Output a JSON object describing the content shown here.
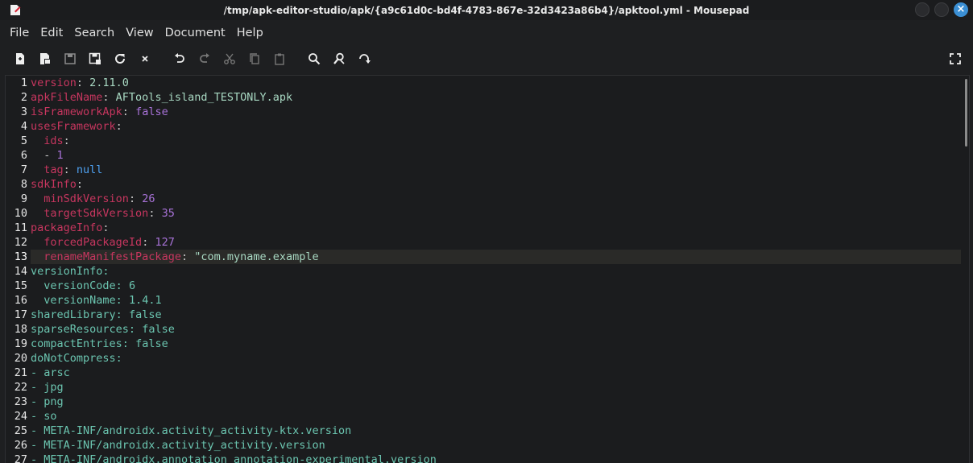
{
  "window": {
    "title": "/tmp/apk-editor-studio/apk/{a9c61d0c-bd4f-4783-867e-32d3423a86b4}/apktool.yml - Mousepad"
  },
  "menu": [
    "File",
    "Edit",
    "Search",
    "View",
    "Document",
    "Help"
  ],
  "toolbar": {
    "icons": [
      "new-document-icon",
      "new-window-icon",
      "save-icon",
      "save-as-icon",
      "reload-icon",
      "close-icon",
      "undo-icon",
      "redo-icon",
      "cut-icon",
      "copy-icon",
      "paste-icon",
      "search-icon",
      "replace-icon",
      "goto-icon",
      "fullscreen-icon"
    ]
  },
  "editor": {
    "current_line": 13,
    "lines": [
      {
        "n": "1",
        "indent": "",
        "key": "version",
        "sep": ": ",
        "val": "2.11.0",
        "type": "k",
        "vtype": "s"
      },
      {
        "n": "2",
        "indent": "",
        "key": "apkFileName",
        "sep": ": ",
        "val": "AFTools_island_TESTONLY.apk",
        "type": "k",
        "vtype": "s"
      },
      {
        "n": "3",
        "indent": "",
        "key": "isFrameworkApk",
        "sep": ": ",
        "val": "false",
        "type": "k",
        "vtype": "bool"
      },
      {
        "n": "4",
        "indent": "",
        "key": "usesFramework",
        "sep": ":",
        "val": "",
        "type": "k",
        "vtype": "s"
      },
      {
        "n": "5",
        "indent": "  ",
        "key": "ids",
        "sep": ":",
        "val": "",
        "type": "k",
        "vtype": "s"
      },
      {
        "n": "6",
        "indent": "  ",
        "key": "- ",
        "sep": "",
        "val": "1",
        "type": "p",
        "vtype": "num"
      },
      {
        "n": "7",
        "indent": "  ",
        "key": "tag",
        "sep": ": ",
        "val": "null",
        "type": "k",
        "vtype": "null"
      },
      {
        "n": "8",
        "indent": "",
        "key": "sdkInfo",
        "sep": ":",
        "val": "",
        "type": "k",
        "vtype": "s"
      },
      {
        "n": "9",
        "indent": "  ",
        "key": "minSdkVersion",
        "sep": ": ",
        "val": "26",
        "type": "k",
        "vtype": "num"
      },
      {
        "n": "10",
        "indent": "  ",
        "key": "targetSdkVersion",
        "sep": ": ",
        "val": "35",
        "type": "k",
        "vtype": "num"
      },
      {
        "n": "11",
        "indent": "",
        "key": "packageInfo",
        "sep": ":",
        "val": "",
        "type": "k",
        "vtype": "s"
      },
      {
        "n": "12",
        "indent": "  ",
        "key": "forcedPackageId",
        "sep": ": ",
        "val": "127",
        "type": "k",
        "vtype": "num"
      },
      {
        "n": "13",
        "indent": "  ",
        "key": "renameManifestPackage",
        "sep": ": ",
        "val": "\"com.myname.example",
        "type": "k",
        "vtype": "s"
      },
      {
        "n": "14",
        "indent": "",
        "key": "versionInfo",
        "sep": ":",
        "val": "",
        "type": "k2",
        "vtype": "s"
      },
      {
        "n": "15",
        "indent": "  ",
        "key": "versionCode",
        "sep": ": ",
        "val": "6",
        "type": "k2",
        "vtype": "s"
      },
      {
        "n": "16",
        "indent": "  ",
        "key": "versionName",
        "sep": ": ",
        "val": "1.4.1",
        "type": "k2",
        "vtype": "s"
      },
      {
        "n": "17",
        "indent": "",
        "key": "sharedLibrary",
        "sep": ": ",
        "val": "false",
        "type": "k2",
        "vtype": "s"
      },
      {
        "n": "18",
        "indent": "",
        "key": "sparseResources",
        "sep": ": ",
        "val": "false",
        "type": "k2",
        "vtype": "s"
      },
      {
        "n": "19",
        "indent": "",
        "key": "compactEntries",
        "sep": ": ",
        "val": "false",
        "type": "k2",
        "vtype": "s"
      },
      {
        "n": "20",
        "indent": "",
        "key": "doNotCompress",
        "sep": ":",
        "val": "",
        "type": "k2",
        "vtype": "s"
      },
      {
        "n": "21",
        "indent": "",
        "key": "- ",
        "sep": "",
        "val": "arsc",
        "type": "k2",
        "vtype": "s"
      },
      {
        "n": "22",
        "indent": "",
        "key": "- ",
        "sep": "",
        "val": "jpg",
        "type": "k2",
        "vtype": "s"
      },
      {
        "n": "23",
        "indent": "",
        "key": "- ",
        "sep": "",
        "val": "png",
        "type": "k2",
        "vtype": "s"
      },
      {
        "n": "24",
        "indent": "",
        "key": "- ",
        "sep": "",
        "val": "so",
        "type": "k2",
        "vtype": "s"
      },
      {
        "n": "25",
        "indent": "",
        "key": "- ",
        "sep": "",
        "val": "META-INF/androidx.activity_activity-ktx.version",
        "type": "k2",
        "vtype": "s"
      },
      {
        "n": "26",
        "indent": "",
        "key": "- ",
        "sep": "",
        "val": "META-INF/androidx.activity_activity.version",
        "type": "k2",
        "vtype": "s"
      },
      {
        "n": "27",
        "indent": "",
        "key": "- ",
        "sep": "",
        "val": "META-INF/androidx.annotation_annotation-experimental.version",
        "type": "k2",
        "vtype": "s"
      }
    ]
  }
}
